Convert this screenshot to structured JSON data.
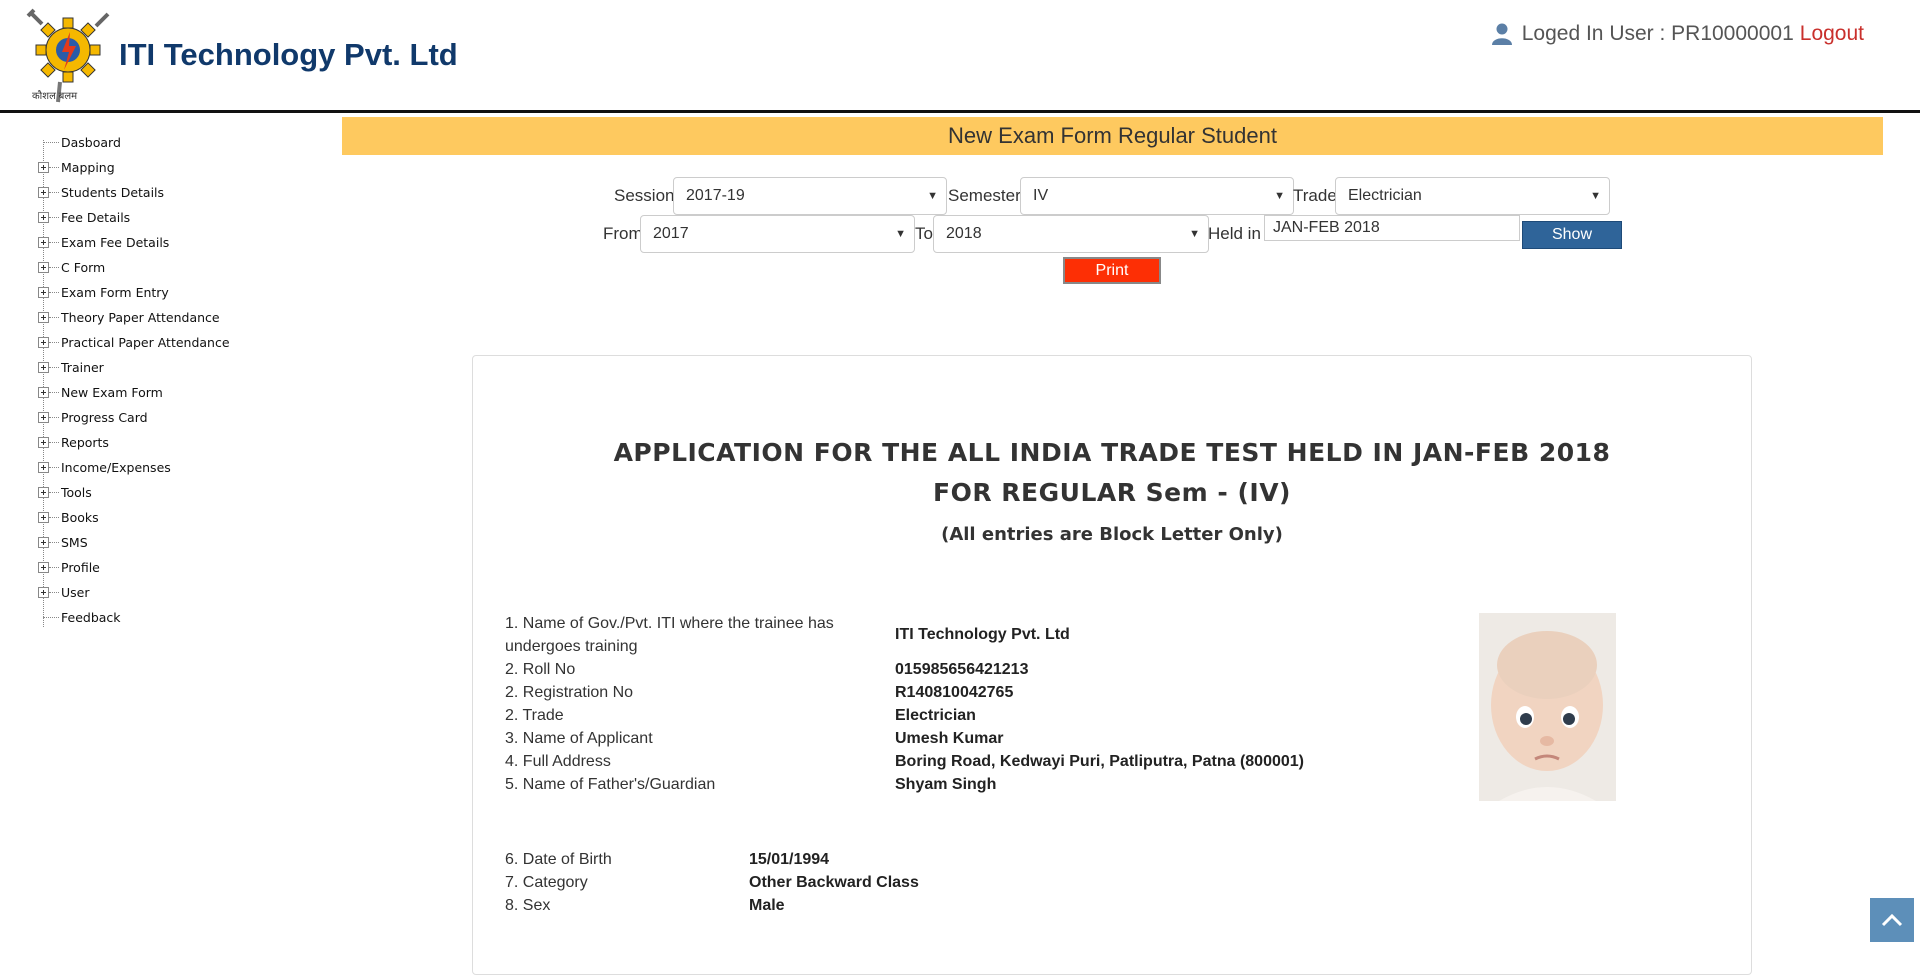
{
  "header": {
    "brand": "ITI Technology Pvt. Ltd",
    "logo_tagline": "कौशल बलम",
    "user_label": "Loged In User : PR10000001",
    "logout_label": "Logout",
    "user_icon": "user-icon"
  },
  "sidebar": {
    "items": [
      {
        "label": "Dasboard",
        "expandable": false
      },
      {
        "label": "Mapping",
        "expandable": true
      },
      {
        "label": "Students Details",
        "expandable": true
      },
      {
        "label": "Fee Details",
        "expandable": true
      },
      {
        "label": "Exam Fee Details",
        "expandable": true
      },
      {
        "label": "C Form",
        "expandable": true
      },
      {
        "label": "Exam Form Entry",
        "expandable": true
      },
      {
        "label": "Theory Paper Attendance",
        "expandable": true
      },
      {
        "label": "Practical Paper Attendance",
        "expandable": true
      },
      {
        "label": "Trainer",
        "expandable": true
      },
      {
        "label": "New Exam Form",
        "expandable": true
      },
      {
        "label": "Progress Card",
        "expandable": true
      },
      {
        "label": "Reports",
        "expandable": true
      },
      {
        "label": "Income/Expenses",
        "expandable": true
      },
      {
        "label": "Tools",
        "expandable": true
      },
      {
        "label": "Books",
        "expandable": true
      },
      {
        "label": "SMS",
        "expandable": true
      },
      {
        "label": "Profile",
        "expandable": true
      },
      {
        "label": "User",
        "expandable": true
      },
      {
        "label": "Feedback",
        "expandable": false
      }
    ]
  },
  "page": {
    "title": "New Exam Form Regular Student"
  },
  "filters": {
    "session_label": "Session",
    "session_value": "2017-19",
    "semester_label": "Semester",
    "semester_value": "IV",
    "trade_label": "Trade",
    "trade_value": "Electrician",
    "from_label": "From",
    "from_value": "2017",
    "to_label": "To",
    "to_value": "2018",
    "held_label": "Held in",
    "held_value": "JAN-FEB 2018",
    "show_label": "Show",
    "print_label": "Print"
  },
  "document": {
    "title_line1": "APPLICATION FOR THE ALL INDIA TRADE TEST HELD IN JAN-FEB 2018",
    "title_line2": "FOR REGULAR Sem - (IV)",
    "title_line3": "(All entries are Block Letter Only)",
    "fields": [
      {
        "label": "1. Name of Gov./Pvt. ITI where the trainee has undergoes training",
        "value": "ITI Technology Pvt. Ltd"
      },
      {
        "label": "2. Roll No",
        "value": "015985656421213"
      },
      {
        "label": "2. Registration No",
        "value": "R140810042765"
      },
      {
        "label": "2. Trade",
        "value": "Electrician"
      },
      {
        "label": "3. Name of Applicant",
        "value": "Umesh Kumar"
      },
      {
        "label": "4. Full Address",
        "value": "Boring Road, Kedwayi Puri, Patliputra, Patna (800001)"
      },
      {
        "label": "5. Name of Father's/Guardian",
        "value": "Shyam Singh"
      }
    ],
    "fields2": [
      {
        "label": "6. Date of Birth",
        "value": "15/01/1994"
      },
      {
        "label": "7. Category",
        "value": "Other Backward Class"
      },
      {
        "label": "8. Sex",
        "value": "Male"
      }
    ]
  }
}
